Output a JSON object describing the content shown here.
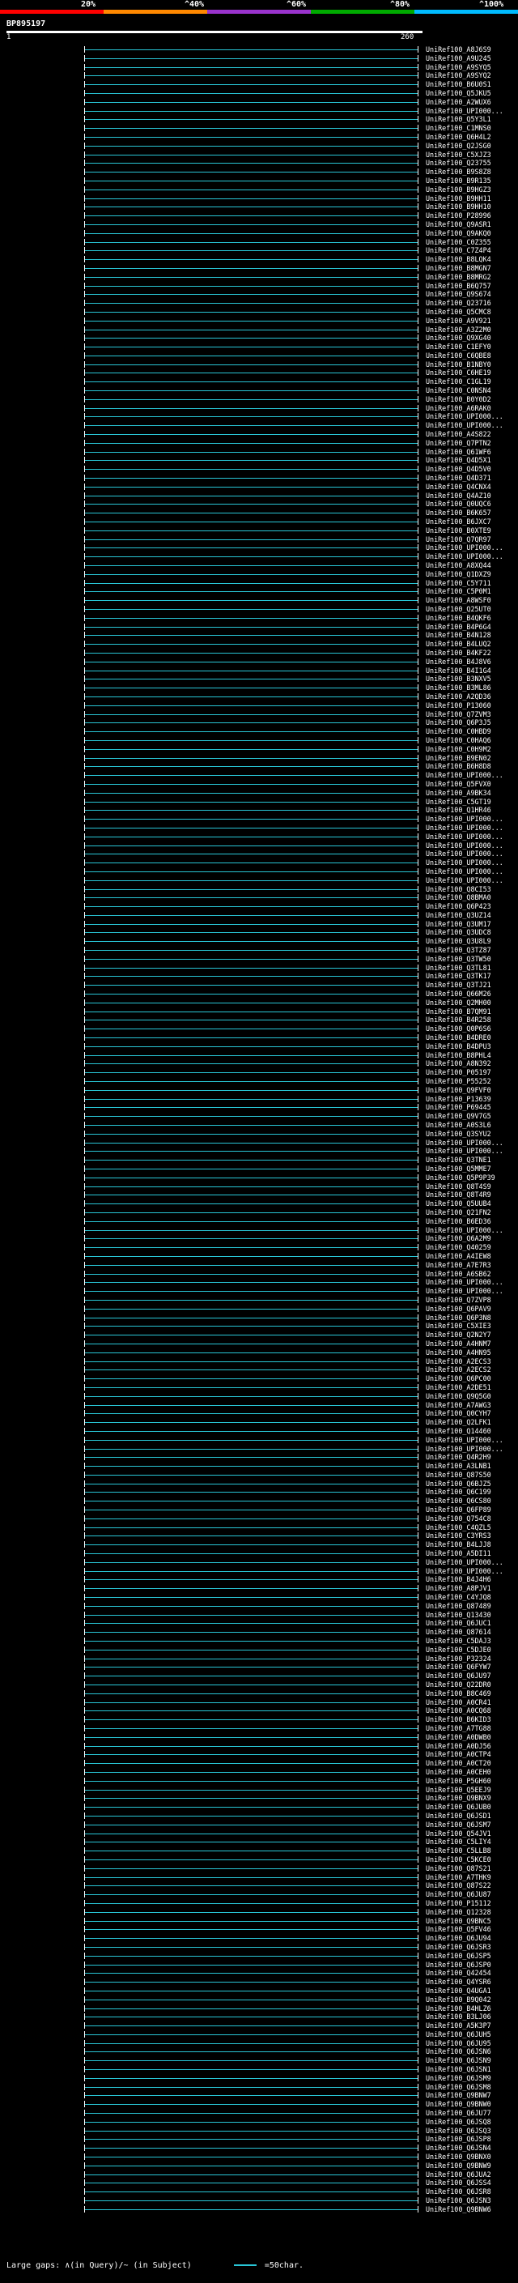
{
  "scale": {
    "labels": [
      "20%",
      "^40%",
      "^60%",
      "^80%",
      "^100%"
    ],
    "colors": [
      "#ff0000",
      "#ff8800",
      "#9933cc",
      "#00aa00",
      "#00bbff"
    ]
  },
  "query": {
    "title": "BP895197",
    "start": "1",
    "end": "260"
  },
  "colors": {
    "default": "#29c6d6",
    "highlight": "#22cc00"
  },
  "rows": [
    {
      "name": "UniRef100_A8J6S9",
      "s": 104,
      "e": 516
    },
    {
      "name": "UniRef100_A9U245",
      "s": 104,
      "e": 516
    },
    {
      "name": "UniRef100_A9SYQ5",
      "s": 104,
      "e": 516
    },
    {
      "name": "UniRef100_A9SYQ2",
      "s": 104,
      "e": 516
    },
    {
      "name": "UniRef100_B6U0S1",
      "s": 104,
      "e": 516
    },
    {
      "name": "UniRef100_Q5JKU5",
      "s": 104,
      "e": 516
    },
    {
      "name": "UniRef100_A2WUX6",
      "s": 104,
      "e": 516
    },
    {
      "name": "UniRef100_UPI000...",
      "s": 104,
      "e": 516
    },
    {
      "name": "UniRef100_Q5Y3L1",
      "s": 104,
      "e": 516
    },
    {
      "name": "UniRef100_C1MNS0",
      "s": 104,
      "e": 516
    },
    {
      "name": "UniRef100_Q6H4L2",
      "s": 104,
      "e": 516
    },
    {
      "name": "UniRef100_Q2JSG0",
      "s": 104,
      "e": 516
    },
    {
      "name": "UniRef100_C5XJZ3",
      "s": 104,
      "e": 516
    },
    {
      "name": "UniRef100_Q23755",
      "s": 104,
      "e": 516
    },
    {
      "name": "UniRef100_B9S8Z8",
      "s": 104,
      "e": 516
    },
    {
      "name": "UniRef100_B9R135",
      "s": 104,
      "e": 516
    },
    {
      "name": "UniRef100_B9HGZ3",
      "s": 104,
      "e": 516
    },
    {
      "name": "UniRef100_B9HH11",
      "s": 104,
      "e": 516
    },
    {
      "name": "UniRef100_B9HH10",
      "s": 104,
      "e": 516
    },
    {
      "name": "UniRef100_P28996",
      "s": 104,
      "e": 516
    },
    {
      "name": "UniRef100_Q9ASR1",
      "s": 104,
      "e": 516
    },
    {
      "name": "UniRef100_Q9AKQ0",
      "s": 104,
      "e": 516
    },
    {
      "name": "UniRef100_C0Z355",
      "s": 104,
      "e": 516
    },
    {
      "name": "UniRef100_C7Z4P4",
      "s": 104,
      "e": 516
    },
    {
      "name": "UniRef100_B8LQK4",
      "s": 104,
      "e": 516
    },
    {
      "name": "UniRef100_B8MGN7",
      "s": 104,
      "e": 516
    },
    {
      "name": "UniRef100_B8MRG2",
      "s": 104,
      "e": 516
    },
    {
      "name": "UniRef100_B6Q757",
      "s": 104,
      "e": 516
    },
    {
      "name": "UniRef100_Q9S674",
      "s": 104,
      "e": 516
    },
    {
      "name": "UniRef100_Q23716",
      "s": 104,
      "e": 516
    },
    {
      "name": "UniRef100_Q5CMC8",
      "s": 104,
      "e": 516
    },
    {
      "name": "UniRef100_A9V921",
      "s": 104,
      "e": 516
    },
    {
      "name": "UniRef100_A3Z2M0",
      "s": 104,
      "e": 516
    },
    {
      "name": "UniRef100_Q9XG40",
      "s": 104,
      "e": 516
    },
    {
      "name": "UniRef100_C1EFY0",
      "s": 104,
      "e": 516
    },
    {
      "name": "UniRef100_C6QBE8",
      "s": 104,
      "e": 516
    },
    {
      "name": "UniRef100_B1NBY0",
      "s": 104,
      "e": 516
    },
    {
      "name": "UniRef100_C6HE19",
      "s": 104,
      "e": 516
    },
    {
      "name": "UniRef100_C1GL19",
      "s": 104,
      "e": 516
    },
    {
      "name": "UniRef100_C0NSN4",
      "s": 104,
      "e": 516
    },
    {
      "name": "UniRef100_B0Y0D2",
      "s": 104,
      "e": 516
    },
    {
      "name": "UniRef100_A6RAK0",
      "s": 104,
      "e": 516
    },
    {
      "name": "UniRef100_UPI000...",
      "s": 104,
      "e": 516
    },
    {
      "name": "UniRef100_UPI000...",
      "s": 104,
      "e": 516
    },
    {
      "name": "UniRef100_A4S822",
      "s": 104,
      "e": 516
    },
    {
      "name": "UniRef100_Q7PTN2",
      "s": 104,
      "e": 516
    },
    {
      "name": "UniRef100_Q61WF6",
      "s": 104,
      "e": 516
    },
    {
      "name": "UniRef100_Q4D5X1",
      "s": 104,
      "e": 516
    },
    {
      "name": "UniRef100_Q4D5V0",
      "s": 104,
      "e": 516
    },
    {
      "name": "UniRef100_Q4D371",
      "s": 104,
      "e": 516
    },
    {
      "name": "UniRef100_Q4CNX4",
      "s": 104,
      "e": 516
    },
    {
      "name": "UniRef100_Q4AZ10",
      "s": 104,
      "e": 516
    },
    {
      "name": "UniRef100_Q0UQC6",
      "s": 104,
      "e": 516
    },
    {
      "name": "UniRef100_B6K657",
      "s": 104,
      "e": 516
    },
    {
      "name": "UniRef100_B6JXC7",
      "s": 104,
      "e": 516
    },
    {
      "name": "UniRef100_B0XTE9",
      "s": 104,
      "e": 516
    },
    {
      "name": "UniRef100_Q7QR97",
      "s": 104,
      "e": 516
    },
    {
      "name": "UniRef100_UPI000...",
      "s": 104,
      "e": 516
    },
    {
      "name": "UniRef100_UPI000...",
      "s": 104,
      "e": 516
    },
    {
      "name": "UniRef100_A8XQ44",
      "s": 104,
      "e": 516
    },
    {
      "name": "UniRef100_Q1DXZ9",
      "s": 104,
      "e": 516
    },
    {
      "name": "UniRef100_C5Y711",
      "s": 104,
      "e": 516
    },
    {
      "name": "UniRef100_C5P0M1",
      "s": 104,
      "e": 516
    },
    {
      "name": "UniRef100_A8WSF0",
      "s": 104,
      "e": 516
    },
    {
      "name": "UniRef100_Q25UT0",
      "s": 104,
      "e": 516
    },
    {
      "name": "UniRef100_B4QKF6",
      "s": 104,
      "e": 516
    },
    {
      "name": "UniRef100_B4P6G4",
      "s": 104,
      "e": 516
    },
    {
      "name": "UniRef100_B4N128",
      "s": 104,
      "e": 516
    },
    {
      "name": "UniRef100_B4LUQ2",
      "s": 104,
      "e": 516
    },
    {
      "name": "UniRef100_B4KF22",
      "s": 104,
      "e": 516
    },
    {
      "name": "UniRef100_B4J8V6",
      "s": 104,
      "e": 516
    },
    {
      "name": "UniRef100_B4I1G4",
      "s": 104,
      "e": 516
    },
    {
      "name": "UniRef100_B3NXV5",
      "s": 104,
      "e": 516
    },
    {
      "name": "UniRef100_B3ML86",
      "s": 104,
      "e": 516
    },
    {
      "name": "UniRef100_A2QD36",
      "s": 104,
      "e": 516
    },
    {
      "name": "UniRef100_P13060",
      "s": 104,
      "e": 516
    },
    {
      "name": "UniRef100_Q7ZVM3",
      "s": 104,
      "e": 516
    },
    {
      "name": "UniRef100_Q6P3J5",
      "s": 104,
      "e": 516
    },
    {
      "name": "UniRef100_C0HBD9",
      "s": 104,
      "e": 516
    },
    {
      "name": "UniRef100_C0HAQ6",
      "s": 104,
      "e": 516
    },
    {
      "name": "UniRef100_C0H9M2",
      "s": 104,
      "e": 516
    },
    {
      "name": "UniRef100_B9EN02",
      "s": 104,
      "e": 516
    },
    {
      "name": "UniRef100_B6H8D8",
      "s": 104,
      "e": 516
    },
    {
      "name": "UniRef100_UPI000...",
      "s": 104,
      "e": 516
    },
    {
      "name": "UniRef100_Q5FVX0",
      "s": 104,
      "e": 516
    },
    {
      "name": "UniRef100_A9BK34",
      "s": 104,
      "e": 516
    },
    {
      "name": "UniRef100_C5GT19",
      "s": 104,
      "e": 516
    },
    {
      "name": "UniRef100_Q1HR46",
      "s": 104,
      "e": 516
    },
    {
      "name": "UniRef100_UPI000...",
      "s": 104,
      "e": 516
    },
    {
      "name": "UniRef100_UPI000...",
      "s": 104,
      "e": 516
    },
    {
      "name": "UniRef100_UPI000...",
      "s": 104,
      "e": 516
    },
    {
      "name": "UniRef100_UPI000...",
      "s": 104,
      "e": 516
    },
    {
      "name": "UniRef100_UPI000...",
      "s": 104,
      "e": 516
    },
    {
      "name": "UniRef100_UPI000...",
      "s": 104,
      "e": 516
    },
    {
      "name": "UniRef100_UPI000...",
      "s": 104,
      "e": 516
    },
    {
      "name": "UniRef100_UPI000...",
      "s": 104,
      "e": 516
    },
    {
      "name": "UniRef100_Q8CI53",
      "s": 104,
      "e": 516
    },
    {
      "name": "UniRef100_Q8BMA0",
      "s": 104,
      "e": 516
    },
    {
      "name": "UniRef100_Q6P423",
      "s": 104,
      "e": 516
    },
    {
      "name": "UniRef100_Q3UZ14",
      "s": 104,
      "e": 516
    },
    {
      "name": "UniRef100_Q3UM17",
      "s": 104,
      "e": 516
    },
    {
      "name": "UniRef100_Q3UDC8",
      "s": 104,
      "e": 516
    },
    {
      "name": "UniRef100_Q3U8L9",
      "s": 104,
      "e": 516
    },
    {
      "name": "UniRef100_Q3TZ87",
      "s": 104,
      "e": 516
    },
    {
      "name": "UniRef100_Q3TW50",
      "s": 104,
      "e": 516
    },
    {
      "name": "UniRef100_Q3TL81",
      "s": 104,
      "e": 516
    },
    {
      "name": "UniRef100_Q3TK17",
      "s": 104,
      "e": 516
    },
    {
      "name": "UniRef100_Q3TJ21",
      "s": 104,
      "e": 516
    },
    {
      "name": "UniRef100_Q66M26",
      "s": 104,
      "e": 516
    },
    {
      "name": "UniRef100_Q2MH00",
      "s": 104,
      "e": 516
    },
    {
      "name": "UniRef100_B7QM91",
      "s": 104,
      "e": 516
    },
    {
      "name": "UniRef100_B4R258",
      "s": 104,
      "e": 516
    },
    {
      "name": "UniRef100_Q0P6S6",
      "s": 104,
      "e": 516
    },
    {
      "name": "UniRef100_B4DRE0",
      "s": 104,
      "e": 516
    },
    {
      "name": "UniRef100_B4DPU3",
      "s": 104,
      "e": 516
    },
    {
      "name": "UniRef100_B8PHL4",
      "s": 104,
      "e": 516
    },
    {
      "name": "UniRef100_A8N392",
      "s": 104,
      "e": 516
    },
    {
      "name": "UniRef100_P05197",
      "s": 104,
      "e": 516
    },
    {
      "name": "UniRef100_P55252",
      "s": 104,
      "e": 516
    },
    {
      "name": "UniRef100_Q9FVF0",
      "s": 104,
      "e": 516
    },
    {
      "name": "UniRef100_P13639",
      "s": 104,
      "e": 516
    },
    {
      "name": "UniRef100_P69445",
      "s": 104,
      "e": 516
    },
    {
      "name": "UniRef100_Q9V7G5",
      "s": 104,
      "e": 516
    },
    {
      "name": "UniRef100_A0S3L6",
      "s": 104,
      "e": 516
    },
    {
      "name": "UniRef100_Q3SYU2",
      "s": 104,
      "e": 516
    },
    {
      "name": "UniRef100_UPI000...",
      "s": 104,
      "e": 516
    },
    {
      "name": "UniRef100_UPI000...",
      "s": 104,
      "e": 516
    },
    {
      "name": "UniRef100_Q3TNE1",
      "s": 104,
      "e": 516
    },
    {
      "name": "UniRef100_Q5MME7",
      "s": 104,
      "e": 516
    },
    {
      "name": "UniRef100_Q5P9P39",
      "s": 104,
      "e": 516
    },
    {
      "name": "UniRef100_Q8T4S9",
      "s": 104,
      "e": 516
    },
    {
      "name": "UniRef100_Q8T4R9",
      "s": 104,
      "e": 516
    },
    {
      "name": "UniRef100_Q5UUB4",
      "s": 104,
      "e": 516
    },
    {
      "name": "UniRef100_Q21FN2",
      "s": 104,
      "e": 516
    },
    {
      "name": "UniRef100_B6ED36",
      "s": 104,
      "e": 516
    },
    {
      "name": "UniRef100_UPI000...",
      "s": 104,
      "e": 516
    },
    {
      "name": "UniRef100_Q6A2M9",
      "s": 104,
      "e": 516
    },
    {
      "name": "UniRef100_Q40259",
      "s": 104,
      "e": 516
    },
    {
      "name": "UniRef100_A4IEW8",
      "s": 104,
      "e": 516
    },
    {
      "name": "UniRef100_A7E7R3",
      "s": 104,
      "e": 516
    },
    {
      "name": "UniRef100_A6SB62",
      "s": 104,
      "e": 516
    },
    {
      "name": "UniRef100_UPI000...",
      "s": 104,
      "e": 516
    },
    {
      "name": "UniRef100_UPI000...",
      "s": 104,
      "e": 516
    },
    {
      "name": "UniRef100_Q7ZVP8",
      "s": 104,
      "e": 516
    },
    {
      "name": "UniRef100_Q6PAV9",
      "s": 104,
      "e": 516
    },
    {
      "name": "UniRef100_Q6P3N8",
      "s": 104,
      "e": 516
    },
    {
      "name": "UniRef100_C5XIE3",
      "s": 104,
      "e": 516
    },
    {
      "name": "UniRef100_Q2N2Y7",
      "s": 104,
      "e": 516
    },
    {
      "name": "UniRef100_A4HNM7",
      "s": 104,
      "e": 516
    },
    {
      "name": "UniRef100_A4HN95",
      "s": 104,
      "e": 516
    },
    {
      "name": "UniRef100_A2ECS3",
      "s": 104,
      "e": 516
    },
    {
      "name": "UniRef100_A2ECS2",
      "s": 104,
      "e": 516
    },
    {
      "name": "UniRef100_Q6PC00",
      "s": 104,
      "e": 516
    },
    {
      "name": "UniRef100_A2DE51",
      "s": 104,
      "e": 516
    },
    {
      "name": "UniRef100_Q9Q5G0",
      "s": 104,
      "e": 516
    },
    {
      "name": "UniRef100_A7AWG3",
      "s": 104,
      "e": 516
    },
    {
      "name": "UniRef100_Q0CYH7",
      "s": 104,
      "e": 516
    },
    {
      "name": "UniRef100_Q2LFK1",
      "s": 104,
      "e": 516
    },
    {
      "name": "UniRef100_Q14460",
      "s": 104,
      "e": 516
    },
    {
      "name": "UniRef100_UPI000...",
      "s": 104,
      "e": 516
    },
    {
      "name": "UniRef100_UPI000...",
      "s": 104,
      "e": 516
    },
    {
      "name": "UniRef100_Q4R2H9",
      "s": 104,
      "e": 516
    },
    {
      "name": "UniRef100_A3LNB1",
      "s": 104,
      "e": 516
    },
    {
      "name": "UniRef100_Q87S50",
      "s": 104,
      "e": 516
    },
    {
      "name": "UniRef100_Q6BJZ5",
      "s": 104,
      "e": 516
    },
    {
      "name": "UniRef100_Q6C199",
      "s": 104,
      "e": 516
    },
    {
      "name": "UniRef100_Q6CS80",
      "s": 104,
      "e": 516
    },
    {
      "name": "UniRef100_Q6FP89",
      "s": 104,
      "e": 516
    },
    {
      "name": "UniRef100_Q754C8",
      "s": 104,
      "e": 516
    },
    {
      "name": "UniRef100_C4QZL5",
      "s": 104,
      "e": 516
    },
    {
      "name": "UniRef100_C3YRS3",
      "s": 104,
      "e": 516
    },
    {
      "name": "UniRef100_B4LJJ8",
      "s": 104,
      "e": 516
    },
    {
      "name": "UniRef100_A5DI11",
      "s": 104,
      "e": 516
    },
    {
      "name": "UniRef100_UPI000...",
      "s": 104,
      "e": 516
    },
    {
      "name": "UniRef100_UPI000...",
      "s": 104,
      "e": 516
    },
    {
      "name": "UniRef100_B4J4H6",
      "s": 104,
      "e": 516
    },
    {
      "name": "UniRef100_A8PJV1",
      "s": 104,
      "e": 516
    },
    {
      "name": "UniRef100_C4YJQ8",
      "s": 104,
      "e": 516
    },
    {
      "name": "UniRef100_Q87489",
      "s": 104,
      "e": 516
    },
    {
      "name": "UniRef100_Q13430",
      "s": 104,
      "e": 516
    },
    {
      "name": "UniRef100_Q6JUC1",
      "s": 104,
      "e": 516
    },
    {
      "name": "UniRef100_Q87614",
      "s": 104,
      "e": 516
    },
    {
      "name": "UniRef100_C5DAJ3",
      "s": 104,
      "e": 516
    },
    {
      "name": "UniRef100_C5DJE0",
      "s": 104,
      "e": 516
    },
    {
      "name": "UniRef100_P32324",
      "s": 104,
      "e": 516
    },
    {
      "name": "UniRef100_Q6FYW7",
      "s": 104,
      "e": 516
    },
    {
      "name": "UniRef100_Q6JU97",
      "s": 104,
      "e": 516
    },
    {
      "name": "UniRef100_Q22DR0",
      "s": 104,
      "e": 516
    },
    {
      "name": "UniRef100_B8C469",
      "s": 104,
      "e": 516
    },
    {
      "name": "UniRef100_A0CR41",
      "s": 104,
      "e": 516
    },
    {
      "name": "UniRef100_A0CQ68",
      "s": 104,
      "e": 516
    },
    {
      "name": "UniRef100_B6KID3",
      "s": 104,
      "e": 516
    },
    {
      "name": "UniRef100_A7TG88",
      "s": 104,
      "e": 516
    },
    {
      "name": "UniRef100_A0DWB0",
      "s": 104,
      "e": 516
    },
    {
      "name": "UniRef100_A0DJ56",
      "s": 104,
      "e": 516
    },
    {
      "name": "UniRef100_A0CTP4",
      "s": 104,
      "e": 516
    },
    {
      "name": "UniRef100_A0CT20",
      "s": 104,
      "e": 516
    },
    {
      "name": "UniRef100_A0CEH0",
      "s": 104,
      "e": 516
    },
    {
      "name": "UniRef100_P5GH60",
      "s": 104,
      "e": 516
    },
    {
      "name": "UniRef100_Q5EEJ9",
      "s": 104,
      "e": 516
    },
    {
      "name": "UniRef100_Q9BNX9",
      "s": 104,
      "e": 516
    },
    {
      "name": "UniRef100_Q6JUB0",
      "s": 104,
      "e": 516
    },
    {
      "name": "UniRef100_Q6JSD1",
      "s": 104,
      "e": 516
    },
    {
      "name": "UniRef100_Q6JSM7",
      "s": 104,
      "e": 516
    },
    {
      "name": "UniRef100_Q54JV1",
      "s": 104,
      "e": 516
    },
    {
      "name": "UniRef100_C5LIY4",
      "s": 104,
      "e": 516
    },
    {
      "name": "UniRef100_C5LLB8",
      "s": 104,
      "e": 516
    },
    {
      "name": "UniRef100_C5KCE0",
      "s": 104,
      "e": 516
    },
    {
      "name": "UniRef100_Q87S21",
      "s": 104,
      "e": 516
    },
    {
      "name": "UniRef100_A7THK9",
      "s": 104,
      "e": 516
    },
    {
      "name": "UniRef100_Q87S22",
      "s": 104,
      "e": 516
    },
    {
      "name": "UniRef100_Q6JU87",
      "s": 104,
      "e": 516
    },
    {
      "name": "UniRef100_P15112",
      "s": 104,
      "e": 516
    },
    {
      "name": "UniRef100_Q12328",
      "s": 104,
      "e": 516
    },
    {
      "name": "UniRef100_Q9BNC5",
      "s": 104,
      "e": 516
    },
    {
      "name": "UniRef100_Q5FV46",
      "s": 104,
      "e": 516
    },
    {
      "name": "UniRef100_Q6JU94",
      "s": 104,
      "e": 516
    },
    {
      "name": "UniRef100_Q6JSR3",
      "s": 104,
      "e": 516
    },
    {
      "name": "UniRef100_Q6JSP5",
      "s": 104,
      "e": 516
    },
    {
      "name": "UniRef100_Q6JSP0",
      "s": 104,
      "e": 516
    },
    {
      "name": "UniRef100_Q42454",
      "s": 104,
      "e": 516
    },
    {
      "name": "UniRef100_Q4YSR6",
      "s": 104,
      "e": 516
    },
    {
      "name": "UniRef100_Q4UGA1",
      "s": 104,
      "e": 516
    },
    {
      "name": "UniRef100_B9Q042",
      "s": 104,
      "e": 516
    },
    {
      "name": "UniRef100_B4HLZ6",
      "s": 104,
      "e": 516
    },
    {
      "name": "UniRef100_B3LJ06",
      "s": 104,
      "e": 516
    },
    {
      "name": "UniRef100_A5K3P7",
      "s": 104,
      "e": 516
    },
    {
      "name": "UniRef100_Q6JUH5",
      "s": 104,
      "e": 516
    },
    {
      "name": "UniRef100_Q6JU95",
      "s": 104,
      "e": 516
    },
    {
      "name": "UniRef100_Q6JSN6",
      "s": 104,
      "e": 516
    },
    {
      "name": "UniRef100_Q6JSN9",
      "s": 104,
      "e": 516
    },
    {
      "name": "UniRef100_Q6JSN1",
      "s": 104,
      "e": 516
    },
    {
      "name": "UniRef100_Q6JSM9",
      "s": 104,
      "e": 516
    },
    {
      "name": "UniRef100_Q6JSM8",
      "s": 104,
      "e": 516
    },
    {
      "name": "UniRef100_Q9BNW7",
      "s": 104,
      "e": 516
    },
    {
      "name": "UniRef100_Q9BNW0",
      "s": 104,
      "e": 516
    },
    {
      "name": "UniRef100_Q6JU77",
      "s": 104,
      "e": 516
    },
    {
      "name": "UniRef100_Q6JSQ8",
      "s": 104,
      "e": 516
    },
    {
      "name": "UniRef100_Q6JSQ3",
      "s": 104,
      "e": 516
    },
    {
      "name": "UniRef100_Q6JSP8",
      "s": 104,
      "e": 516
    },
    {
      "name": "UniRef100_Q6JSN4",
      "s": 104,
      "e": 516
    },
    {
      "name": "UniRef100_Q9BNX0",
      "s": 104,
      "e": 516
    },
    {
      "name": "UniRef100_Q9BNW9",
      "s": 104,
      "e": 516
    },
    {
      "name": "UniRef100_Q6JUA2",
      "s": 104,
      "e": 516
    },
    {
      "name": "UniRef100_Q6JSS4",
      "s": 104,
      "e": 516
    },
    {
      "name": "UniRef100_Q6JSR8",
      "s": 104,
      "e": 516
    },
    {
      "name": "UniRef100_Q6JSN3",
      "s": 104,
      "e": 516
    },
    {
      "name": "UniRef100_Q9BNW6",
      "s": 104,
      "e": 516
    }
  ],
  "footer": {
    "gaps_text": "Large gaps: ∧(in Query)/~ (in Subject)",
    "legend_text": "=50char."
  }
}
